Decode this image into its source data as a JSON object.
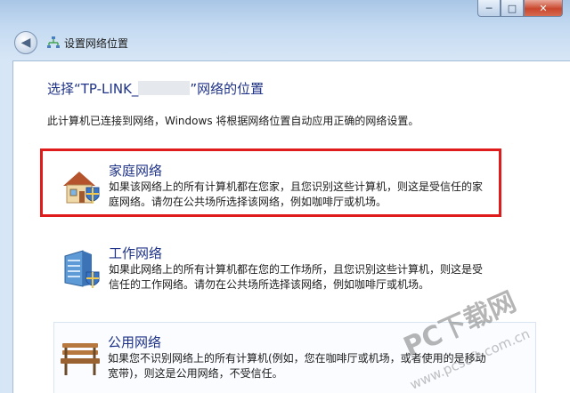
{
  "window": {
    "min": "─",
    "max": "□",
    "close": "✕"
  },
  "nav": {
    "title": "设置网络位置",
    "icon": "network-icon"
  },
  "heading": {
    "prefix": "选择“TP-LINK_",
    "suffix": "”网络的位置"
  },
  "description": "此计算机已连接到网络，Windows 将根据网络位置自动应用正确的网络设置。",
  "options": [
    {
      "title": "家庭网络",
      "desc": "如果该网络上的所有计算机都在您家，且您识别这些计算机，则这是受信任的家庭网络。请勿在公共场所选择该网络，例如咖啡厅或机场。",
      "icon": "home-network-icon"
    },
    {
      "title": "工作网络",
      "desc": "如果此网络上的所有计算机都在您的工作场所，且您识别这些计算机，则这是受信任的工作网络。请勿在公共场所选择该网络，例如咖啡厅或机场。",
      "icon": "work-network-icon"
    },
    {
      "title": "公用网络",
      "desc": "如果您不识别网络上的所有计算机(例如，您在咖啡厅或机场，或者使用的是移动宽带)，则这是公用网络，不受信任。",
      "icon": "public-network-icon"
    }
  ],
  "watermark": {
    "main": "PC下载网",
    "url": "www.pcsoft.com.cn"
  },
  "colors": {
    "link": "#1e3287",
    "highlight": "#e01b1b"
  }
}
